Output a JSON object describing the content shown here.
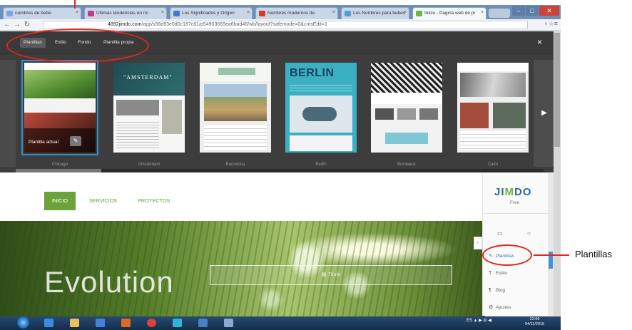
{
  "browser": {
    "tabs": [
      {
        "label": "nombres de bebe",
        "color": "#7aa6d9"
      },
      {
        "label": "Ultimas tendencias en nc",
        "color": "#c23a8a"
      },
      {
        "label": "Los Significados y Origen",
        "color": "#3b7ad1"
      },
      {
        "label": "Nombres modernos de",
        "color": "#d53a2c"
      },
      {
        "label": "Los Nombres para bebes",
        "color": "#4ea0d9"
      },
      {
        "label": "Inicio - Pagina web de pr",
        "color": "#6cb63c"
      }
    ],
    "url_prefix": "",
    "url_domain": "4892jimdo.com",
    "url_path": "/app/s58d93e0d0c187c81/p54903669ea6bad48/wb/layout?safemode=0&cmsEdit=1",
    "window_controls": [
      "–",
      "□",
      "✕"
    ],
    "addr_icons": "♀☆≡"
  },
  "panel": {
    "nav": [
      "Plantillas",
      "Estilo",
      "Fondo",
      "Plantilla propia"
    ],
    "active_nav": "Plantillas",
    "close": "×",
    "templates": [
      {
        "name": "Chicago",
        "current": true
      },
      {
        "name": "Amsterdam"
      },
      {
        "name": "Barcelona"
      },
      {
        "name": "Berlin"
      },
      {
        "name": "Bordeaux"
      },
      {
        "name": "Cairo"
      }
    ],
    "current_label": "Plantilla actual",
    "amsterdam_title": "\"AMSTERDAM\"",
    "berlin_word": "BERLIN",
    "next_arrow": "▶"
  },
  "site": {
    "nav": [
      "INICIO",
      "SERVICIOS",
      "PROYECTOS"
    ],
    "hero_title": "Evolution",
    "hero_input_label": "Título"
  },
  "jimdo_sidebar": {
    "logo_a": "JI",
    "logo_b": "M",
    "logo_c": "DO",
    "plan": "Free",
    "items": [
      {
        "label": "Plantillas",
        "icon": "✎",
        "active": true
      },
      {
        "label": "Estilo",
        "icon": "T"
      },
      {
        "label": "Blog",
        "icon": "¶"
      },
      {
        "label": "Ajustes",
        "icon": "⚙"
      }
    ],
    "collapse": "›"
  },
  "taskbar": {
    "tray_text": "ES ▲ ▶ ⊟ ◀",
    "time": "22:06",
    "date": "04/11/2015"
  },
  "annotations": {
    "right_label": "Plantillas"
  },
  "colors": {
    "accent_green": "#6ba33a",
    "annotation_red": "#e0261e",
    "selection_blue": "#2d8ec9"
  }
}
